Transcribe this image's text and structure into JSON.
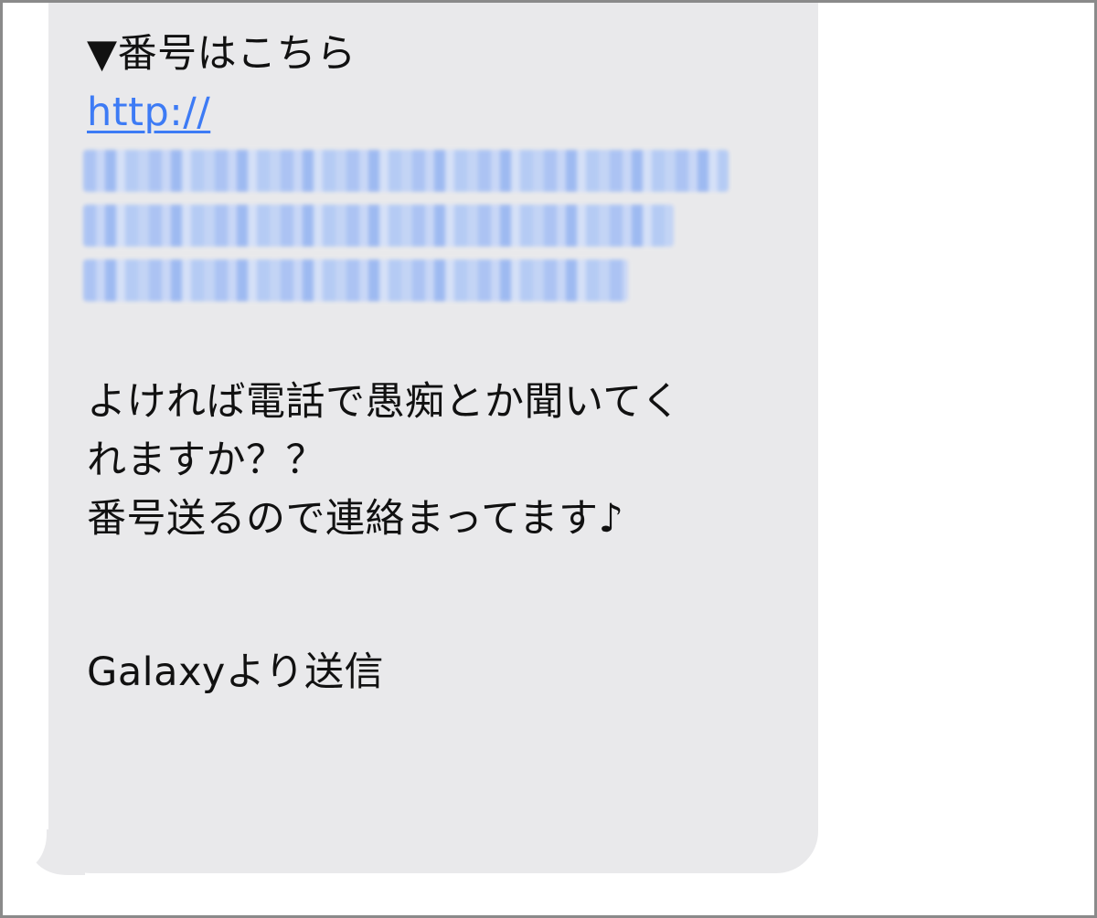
{
  "message": {
    "line1": "▼番号はこちら",
    "link_prefix": "http://",
    "line_body1": "よければ電話で愚痴とか聞いてく",
    "line_body2": "れますか？？",
    "line_body3": "番号送るので連絡まってます♪",
    "signature": "Galaxyより送信"
  },
  "colors": {
    "bubble": "#e9e9eb",
    "link": "#3d7bf5",
    "text": "#111111",
    "frame": "#8a8a8a"
  }
}
